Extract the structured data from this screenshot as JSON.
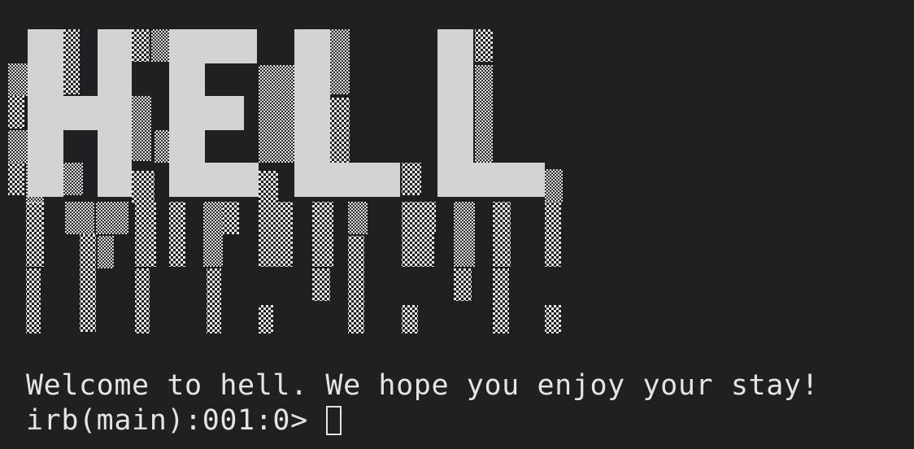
{
  "banner": {
    "text": "HELL",
    "solid_color": "#d2d4d3",
    "shade_color": "#e6e6e6"
  },
  "terminal": {
    "background": "#1f2022",
    "foreground": "#e4e4e4",
    "welcome": "Welcome to hell. We hope you enjoy your stay!",
    "prompt": "irb(main):001:0>"
  }
}
